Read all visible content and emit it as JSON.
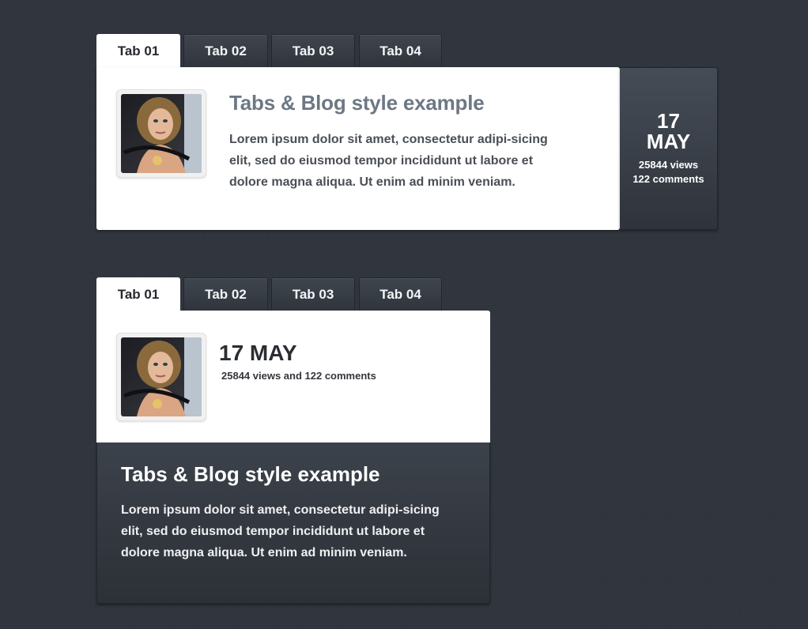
{
  "widget_top": {
    "tabs": [
      {
        "label": "Tab 01",
        "active": true
      },
      {
        "label": "Tab 02",
        "active": false
      },
      {
        "label": "Tab 03",
        "active": false
      },
      {
        "label": "Tab 04",
        "active": false
      }
    ],
    "post": {
      "title": "Tabs & Blog style example",
      "excerpt": "Lorem ipsum dolor sit amet, consectetur adipi-sicing elit, sed do eiusmod tempor incididunt ut labore et dolore magna aliqua. Ut enim ad minim veniam."
    },
    "date": {
      "day": "17",
      "month": "MAY",
      "views": "25844 views",
      "comments": "122 comments"
    }
  },
  "widget_bottom": {
    "tabs": [
      {
        "label": "Tab 01",
        "active": true
      },
      {
        "label": "Tab 02",
        "active": false
      },
      {
        "label": "Tab 03",
        "active": false
      },
      {
        "label": "Tab 04",
        "active": false
      }
    ],
    "date": "17 MAY",
    "stats": "25844 views and 122 comments",
    "post": {
      "title": "Tabs & Blog style example",
      "excerpt": "Lorem ipsum dolor sit amet, consectetur adipi-sicing elit, sed do eiusmod tempor incididunt ut labore et dolore magna aliqua. Ut enim ad minim veniam."
    }
  },
  "icons": {
    "thumbnail": "photo-thumbnail-icon"
  }
}
